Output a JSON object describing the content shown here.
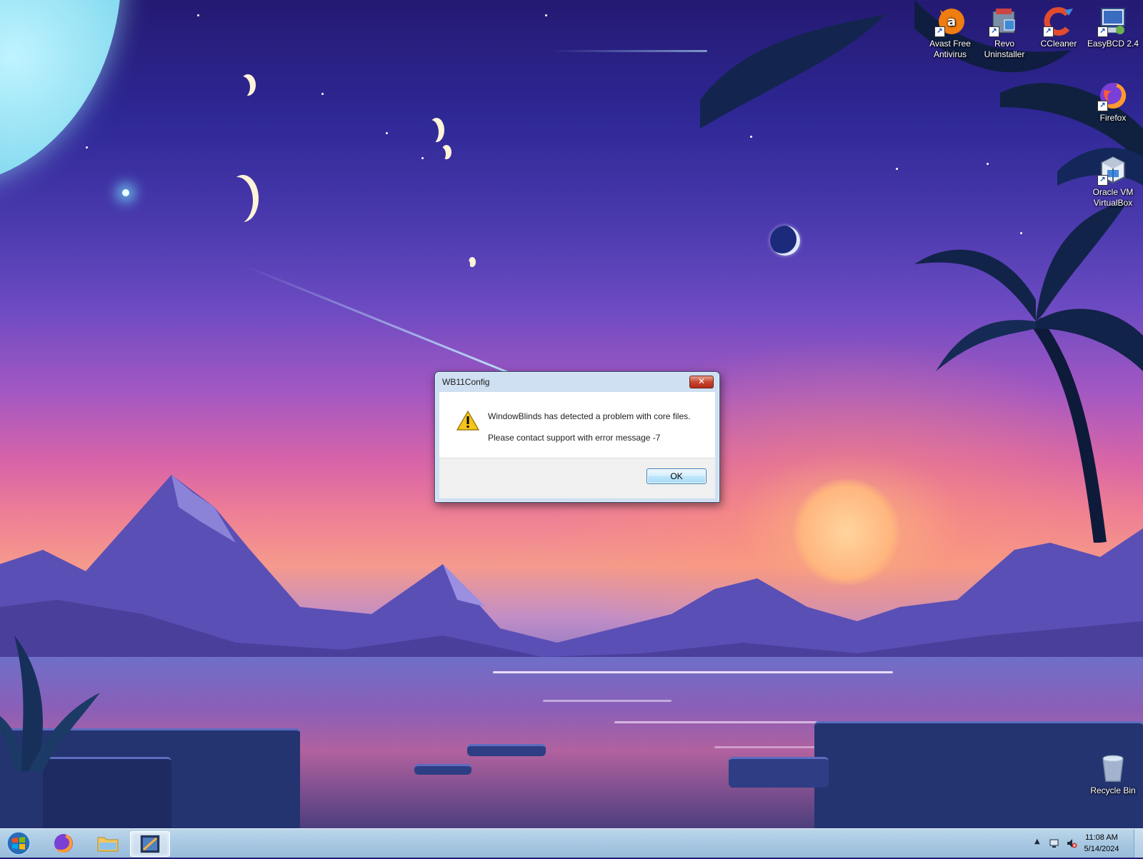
{
  "desktop": {
    "icons": [
      {
        "label": "Avast Free Antivirus",
        "icon": "avast-icon"
      },
      {
        "label": "Revo Uninstaller",
        "icon": "revo-uninstaller-icon"
      },
      {
        "label": "CCleaner",
        "icon": "ccleaner-icon"
      },
      {
        "label": "EasyBCD 2.4",
        "icon": "easybcd-icon"
      },
      {
        "label": "Firefox",
        "icon": "firefox-icon"
      },
      {
        "label": "Oracle VM VirtualBox",
        "icon": "virtualbox-icon"
      },
      {
        "label": "Recycle Bin",
        "icon": "recycle-bin-icon"
      }
    ]
  },
  "dialog": {
    "title": "WB11Config",
    "close_label": "✕",
    "message_line1": "WindowBlinds has detected a problem with core files.",
    "message_line2": "Please contact support with error message -7",
    "ok_label": "OK",
    "icon": "warning-icon"
  },
  "taskbar": {
    "start_icon": "windows-start-icon",
    "pinned": [
      {
        "name": "firefox",
        "icon": "firefox-icon",
        "active": false
      },
      {
        "name": "file-explorer",
        "icon": "folder-icon",
        "active": false
      },
      {
        "name": "wb11config",
        "icon": "windowblinds-icon",
        "active": true
      }
    ],
    "tray": {
      "show_hidden_icon": "▲",
      "icons": [
        "network-icon",
        "volume-muted-icon"
      ],
      "time": "11:08 AM",
      "date": "5/14/2024"
    }
  },
  "colors": {
    "dialog_frame": "#cfe0f2",
    "ok_button": "#bee6fd",
    "taskbar": "#a8c8e2",
    "close_button": "#c8452f"
  }
}
